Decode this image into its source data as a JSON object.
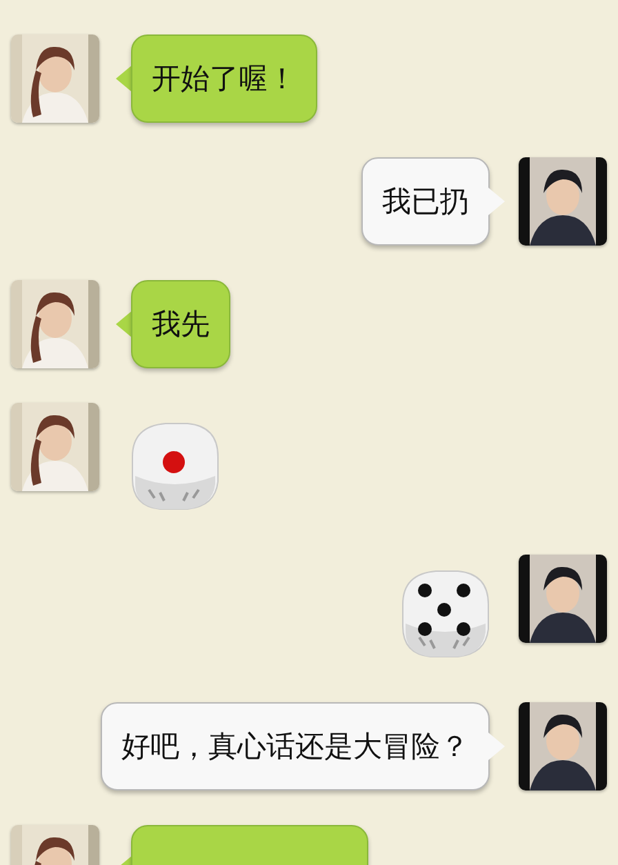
{
  "messages": [
    {
      "outgoing": false,
      "kind": "text",
      "text": "开始了喔！"
    },
    {
      "outgoing": true,
      "kind": "text",
      "text": "我已扔"
    },
    {
      "outgoing": false,
      "kind": "text",
      "text": "我先"
    },
    {
      "outgoing": false,
      "kind": "dice1"
    },
    {
      "outgoing": true,
      "kind": "dice5"
    },
    {
      "outgoing": true,
      "kind": "text",
      "text": "好吧，真心话还是大冒险？"
    },
    {
      "outgoing": false,
      "kind": "text"
    }
  ]
}
